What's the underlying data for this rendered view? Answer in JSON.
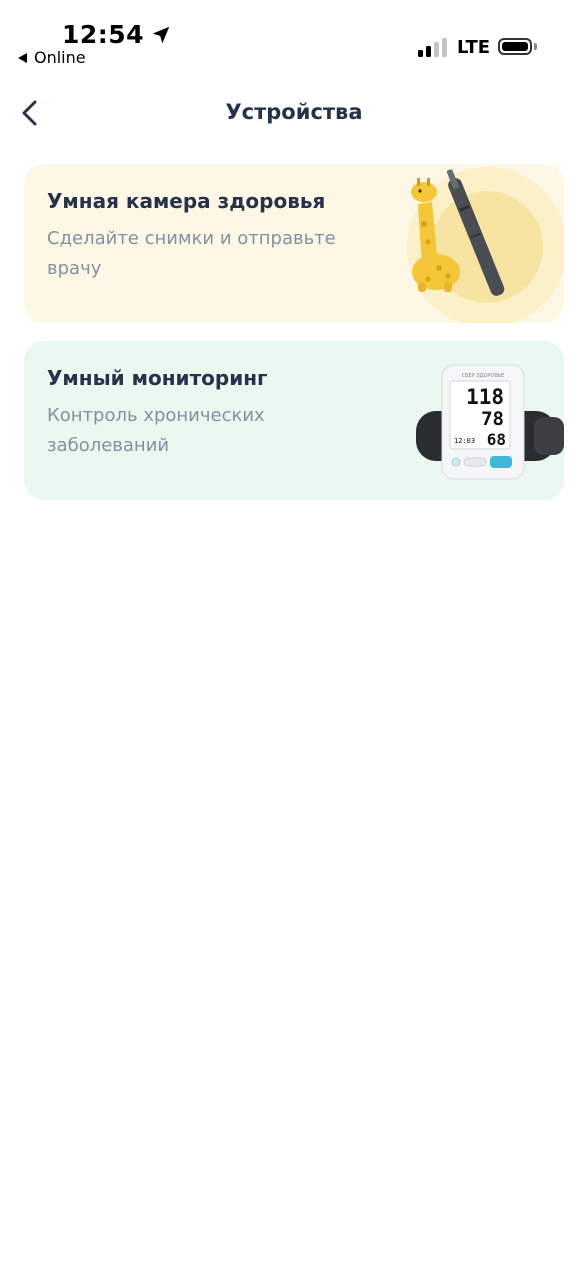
{
  "status_bar": {
    "time": "12:54",
    "back_app": "Online",
    "network": "LTE"
  },
  "nav": {
    "title": "Устройства"
  },
  "cards": [
    {
      "title": "Умная камера здоровья",
      "subtitle": "Сделайте снимки и отправьте врачу",
      "background": "#fdf8e6"
    },
    {
      "title": "Умный мониторинг",
      "subtitle": "Контроль хронических заболеваний",
      "background": "#ebf8ef",
      "device_display": {
        "brand": "СБЕР ЗДОРОВЬЕ",
        "systolic": "118",
        "diastolic": "78",
        "time": "12:03",
        "pulse": "68"
      }
    }
  ],
  "colors": {
    "title_text": "#26324a",
    "subtitle_text": "#8390a3",
    "camera_card_bg": "#fdf8e6",
    "monitor_card_bg": "#ebf8ef",
    "giraffe": "#f4c63a",
    "cuff_button": "#3fb8d8"
  },
  "icons": {
    "location": "location-arrow-icon",
    "back": "chevron-left-icon",
    "signal": "cellular-signal-icon",
    "battery": "battery-icon"
  }
}
